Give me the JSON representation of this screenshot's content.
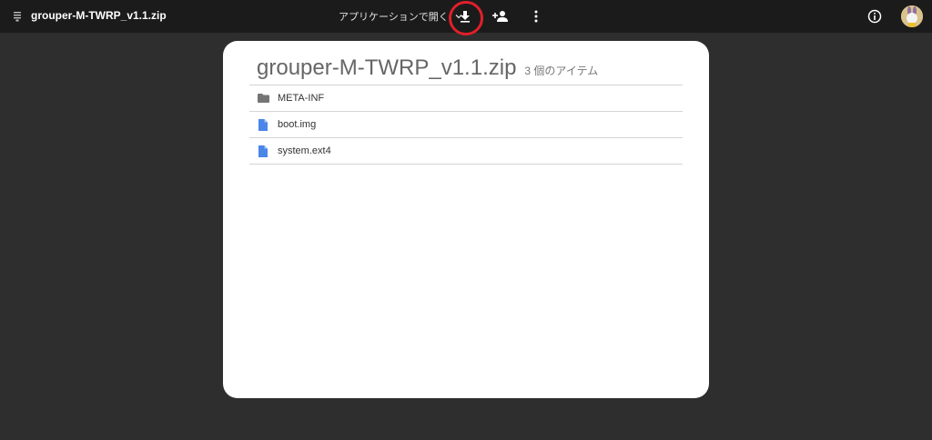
{
  "topbar": {
    "file_name": "grouper-M-TWRP_v1.1.zip",
    "open_with_label": "アプリケーションで開く"
  },
  "viewer": {
    "title": "grouper-M-TWRP_v1.1.zip",
    "item_count": "3 個のアイテム",
    "items": [
      {
        "name": "META-INF",
        "icon": "folder-icon"
      },
      {
        "name": "boot.img",
        "icon": "document-icon"
      },
      {
        "name": "system.ext4",
        "icon": "document-icon"
      }
    ]
  },
  "colors": {
    "background": "#2e2e2e",
    "topbar": "#1b1b1b",
    "highlight": "#e0202a",
    "folder": "#757575",
    "document": "#4a86e8"
  }
}
